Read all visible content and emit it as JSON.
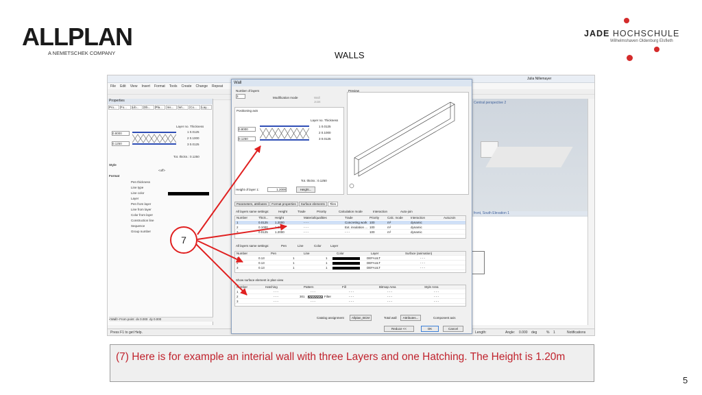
{
  "slide": {
    "title": "WALLS",
    "page_number": "5",
    "caption": "(7) Here is for example an interial wall with three Layers and one Hatching. The Height is 1.20m",
    "callout_number": "7"
  },
  "logos": {
    "left_brand": "ALLPLAN",
    "left_sub": "A NEMETSCHEK COMPANY",
    "right_brand_a": "JADE",
    "right_brand_b": "HOCHSCHULE",
    "right_sub": "Wilhelmshaven Oldenburg Elsfleth"
  },
  "app": {
    "user": "Julia Nillemayer",
    "menu": [
      "File",
      "Edit",
      "View",
      "Insert",
      "Format",
      "Tools",
      "Create",
      "Change",
      "Repeat"
    ],
    "properties_title": "Properties",
    "props_tabs": [
      "Pro...",
      "Fo...",
      "Lib...",
      "Ob...",
      "Pla...",
      "Ins...",
      "Wi...",
      "Co...",
      "Lay..."
    ],
    "layer_no_label": "Layer no.",
    "thickness_label": "Thickness",
    "layers": [
      {
        "no": "1",
        "thickness": "0.0125"
      },
      {
        "no": "2",
        "thickness": "0.1000"
      },
      {
        "no": "3",
        "thickness": "0.0125"
      }
    ],
    "height_value": "0.8000",
    "width_value": "0.1250",
    "total_thick": "Tot. thickn.: 0.1250",
    "style_header": "Style",
    "style_value": "<off>",
    "format_header": "Format",
    "format_rows": [
      "Pen thickness",
      "Line type",
      "Line color",
      "Layer",
      "Pen from layer",
      "Line from layer",
      "Color from layer",
      "Construction line",
      "Sequence",
      "Group number"
    ],
    "viewport_label": "Central perspective 2",
    "elevation_label": "front, South Elevation 1",
    "status_left": "Press F1 to get Help.",
    "status_length": "Length:",
    "status_angle": "Angle:",
    "status_angle_value": "0.000",
    "status_unit": "deg",
    "status_pct": "%",
    "status_scale": "1",
    "status_notifications": "Notifications",
    "wall_from_point": "<Wall> From point",
    "dx_label": "dx",
    "dx_value": "0.000",
    "dy_label": "dy",
    "dy_value": "0.000"
  },
  "dialog": {
    "title": "Wall",
    "num_layers_label": "Number of layers",
    "num_layers_value": "3",
    "mod_mode_label": "Modification mode",
    "opt_wall": "Wall",
    "opt_joint": "Joint",
    "preview_label": "Preview",
    "pos_axis_label": "Positioning axis",
    "layer_no_label": "Layer no.",
    "thickness_label": "Thickness",
    "height_value": "0.8000",
    "width_value": "0.1250",
    "total_thick_label": "Tot. thickn.:",
    "total_thick_value": "0.1250",
    "height_layer_label": "Height of layer 1:",
    "height_layer_value": "1.2000",
    "height_button": "Height...",
    "tabs": [
      "Parameters, attributes",
      "Format properties",
      "Surface elements",
      "Tiles"
    ],
    "same_settings_label": "All layers same settings:",
    "checks_row1": [
      "Height",
      "Trade",
      "Priority",
      "Calculation mode",
      "Interaction",
      "Auto-join"
    ],
    "table1_headers": [
      "Number",
      "Thick...",
      "Height",
      "",
      "Material/qualities",
      "Trade",
      "Priority",
      "Calc. mode",
      "Interaction",
      "AutoJoin"
    ],
    "table1_rows": [
      [
        "1",
        "0.0125",
        "1.2000",
        "- - -",
        "Concreting work",
        "100",
        "m²",
        "dynamic"
      ],
      [
        "2",
        "0.1000",
        "1.2000",
        "- - -",
        "Ext. insulation ...",
        "100",
        "m²",
        "dynamic"
      ],
      [
        "3",
        "0.0125",
        "1.2000",
        "- - -",
        "- - -",
        "100",
        "m²",
        "dynamic"
      ]
    ],
    "checks_row2": [
      "Pen",
      "Line",
      "Color",
      "Layer"
    ],
    "table2_headers": [
      "Number",
      "Pen",
      "Line",
      "Color",
      "Layer",
      "Surface (animation)"
    ],
    "table2_rows": [
      [
        "1",
        "0.13",
        "1",
        "1",
        "DEFAULT",
        "- - -"
      ],
      [
        "2",
        "0.13",
        "1",
        "1",
        "DEFAULT",
        "- - -"
      ],
      [
        "3",
        "0.13",
        "1",
        "1",
        "DEFAULT",
        "- - -"
      ]
    ],
    "show_surface_label": "Show surface element in plan view",
    "table3_headers": [
      "Number",
      "Hatching",
      "Pattern",
      "Fill",
      "Bitmap Area",
      "Style Area"
    ],
    "table3_rows": [
      [
        "1",
        "- - -",
        "- - -",
        "- - -",
        "- - -",
        "- - -"
      ],
      [
        "2",
        "- - -",
        "301",
        "- - -",
        "- - -",
        "- - -"
      ],
      [
        "3",
        "- - -",
        "- - -",
        "- - -",
        "- - -",
        "- - -"
      ]
    ],
    "filter_label": "Filter",
    "catalog_label": "Catalog assignment",
    "catalog_value": "Allplan_BCM",
    "total_wall_label": "Total wall",
    "attributes_button": "Attributes...",
    "component_axis_label": "Component axis",
    "reduce_button": "Reduce <<",
    "ok_button": "OK",
    "cancel_button": "Cancel"
  },
  "colors": {
    "accent_red": "#e02020",
    "caption_red": "#c0232d",
    "selection_blue": "#cfe0f7"
  }
}
